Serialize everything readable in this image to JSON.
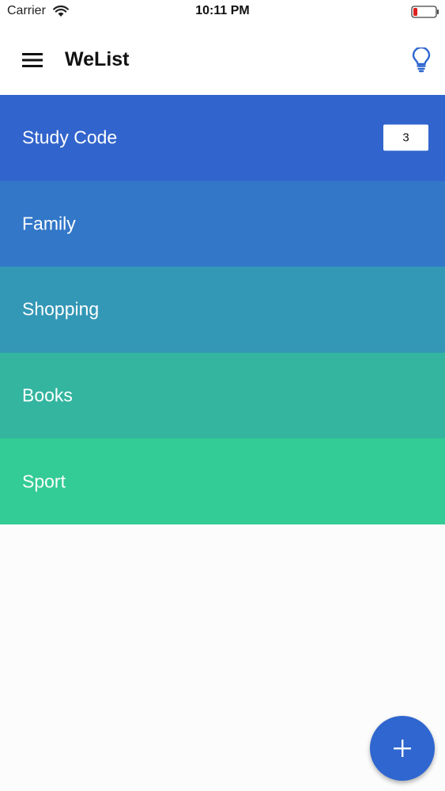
{
  "status_bar": {
    "carrier": "Carrier",
    "time": "10:11 PM"
  },
  "app_bar": {
    "title": "WeList",
    "menu_icon": "hamburger-menu-icon",
    "action_icon": "lightbulb-icon"
  },
  "lists": [
    {
      "label": "Study Code",
      "badge": "3",
      "color": "#3164cc"
    },
    {
      "label": "Family",
      "badge": "",
      "color": "#3277c8"
    },
    {
      "label": "Shopping",
      "badge": "",
      "color": "#3397b6"
    },
    {
      "label": "Books",
      "badge": "",
      "color": "#33b59f"
    },
    {
      "label": "Sport",
      "badge": "",
      "color": "#33cb96"
    }
  ],
  "fab": {
    "icon": "plus-icon",
    "color": "#2f66cf"
  },
  "colors": {
    "accent": "#2f66cf",
    "battery_low": "#e02020"
  }
}
